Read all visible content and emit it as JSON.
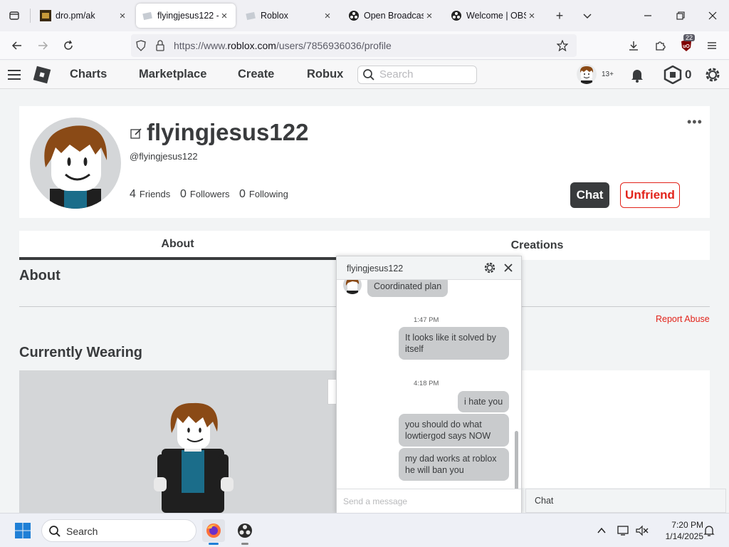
{
  "browser": {
    "tabs": [
      {
        "title": "dro.pm/ak",
        "active": false
      },
      {
        "title": "flyingjesus122 -",
        "active": true
      },
      {
        "title": "Roblox",
        "active": false
      },
      {
        "title": "Open Broadcast",
        "active": false
      },
      {
        "title": "Welcome | OBS",
        "active": false
      }
    ],
    "url_prefix": "https://www.",
    "url_domain": "roblox.com",
    "url_path": "/users/7856936036/profile",
    "extension_badge": "22"
  },
  "roblox_header": {
    "nav": [
      "Charts",
      "Marketplace",
      "Create",
      "Robux"
    ],
    "search_placeholder": "Search",
    "age_badge": "13+",
    "robux_balance": "0"
  },
  "profile": {
    "display_name": "flyingjesus122",
    "username": "@flyingjesus122",
    "stats": [
      {
        "count": "4",
        "label": "Friends"
      },
      {
        "count": "0",
        "label": "Followers"
      },
      {
        "count": "0",
        "label": "Following"
      }
    ],
    "chat_button": "Chat",
    "unfriend_button": "Unfriend",
    "more_label": "•••"
  },
  "profile_tabs": [
    "About",
    "Creations"
  ],
  "about_title": "About",
  "report_abuse": "Report Abuse",
  "currently_wearing_title": "Currently Wearing",
  "chat_window": {
    "title": "flyingjesus122",
    "messages": [
      {
        "text": "Coordinated plan",
        "from": "them"
      },
      {
        "timestamp": "1:47 PM"
      },
      {
        "text": "It looks like it solved by itself",
        "from": "me"
      },
      {
        "timestamp": "4:18 PM"
      },
      {
        "text": "i hate you",
        "from": "me"
      },
      {
        "text": "you should do what lowtiergod says NOW",
        "from": "me"
      },
      {
        "text": "my dad works at roblox he will ban you",
        "from": "me"
      }
    ],
    "input_placeholder": "Send a message"
  },
  "chat_dock_label": "Chat",
  "taskbar": {
    "search_label": "Search",
    "time": "7:20 PM",
    "date": "1/14/2025"
  },
  "colors": {
    "roblox_red": "#e2231a",
    "roblox_dark": "#393b3d",
    "bubble_gray": "#c9cbcd"
  }
}
